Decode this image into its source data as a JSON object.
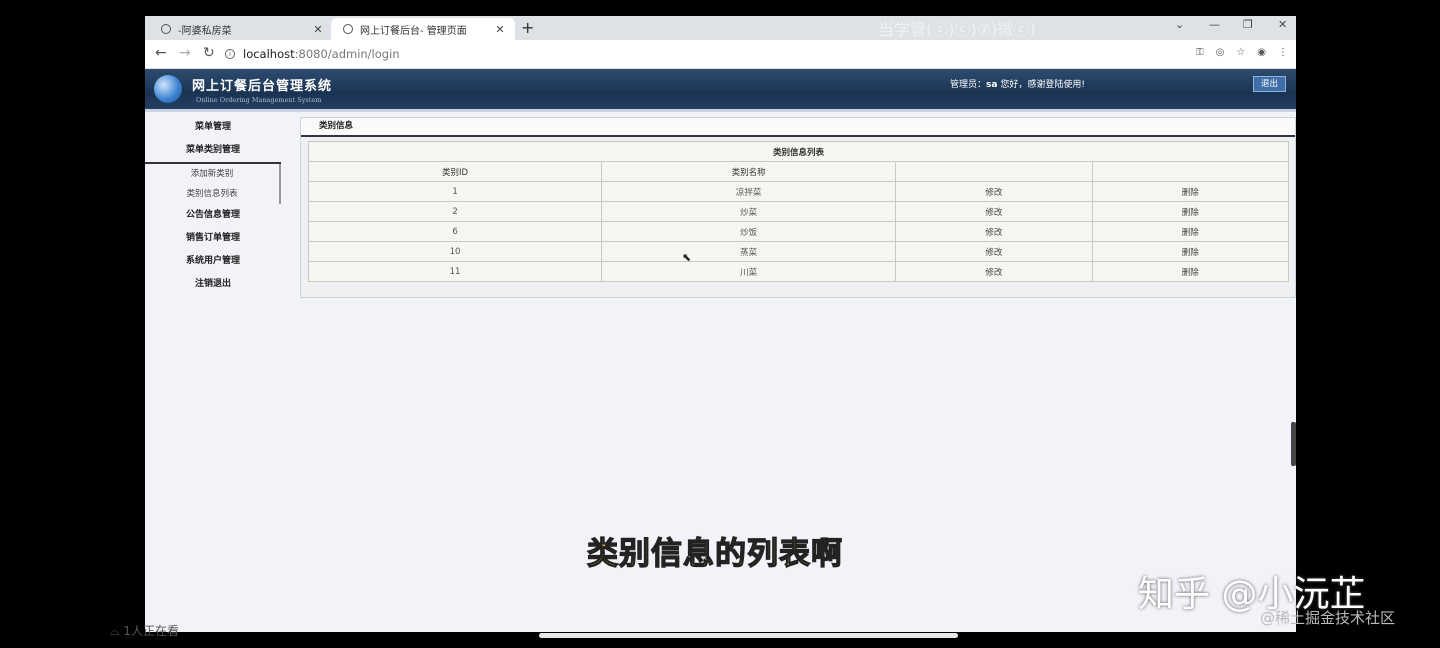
{
  "browser": {
    "tabs": [
      {
        "title": "-阿婆私房菜"
      },
      {
        "title": "网上订餐后台- 管理页面"
      }
    ],
    "new_tab": "+",
    "close_glyph": "✕",
    "url_host": "localhost",
    "url_path": ":8080/admin/login",
    "window_controls": [
      "⌄",
      "—",
      "❐",
      "✕"
    ],
    "overlay_text": "当学管(ⓒ)ⓒ)⑦)微ⓒ)"
  },
  "app": {
    "title": "网上订餐后台管理系统",
    "subtitle": "Online Ordering Management System",
    "greeting_prefix": "管理员：",
    "admin_name": "sa",
    "greeting_suffix": " 您好，感谢登陆使用!",
    "logout_label": "退出"
  },
  "sidebar": {
    "items": [
      {
        "label": "菜单管理"
      },
      {
        "label": "菜单类别管理"
      },
      {
        "label": "公告信息管理"
      },
      {
        "label": "销售订单管理"
      },
      {
        "label": "系统用户管理"
      },
      {
        "label": "注销退出"
      }
    ],
    "sub_items": [
      {
        "label": "添加新类别"
      },
      {
        "label": "类别信息列表"
      }
    ]
  },
  "panel": {
    "title": "类别信息",
    "table_caption": "类别信息列表",
    "columns": [
      "类别ID",
      "类别名称",
      "",
      ""
    ],
    "rows": [
      {
        "id": "1",
        "name": "凉拌菜",
        "edit": "修改",
        "delete": "删除"
      },
      {
        "id": "2",
        "name": "炒菜",
        "edit": "修改",
        "delete": "删除"
      },
      {
        "id": "6",
        "name": "炒饭",
        "edit": "修改",
        "delete": "删除"
      },
      {
        "id": "10",
        "name": "蒸菜",
        "edit": "修改",
        "delete": "删除"
      },
      {
        "id": "11",
        "name": "川菜",
        "edit": "修改",
        "delete": "删除"
      }
    ]
  },
  "overlay": {
    "subtitle": "类别信息的列表啊",
    "zhihu_watermark": "知乎 @小沅芷",
    "juejin_watermark": "@稀土掘金技术社区",
    "viewers": "1人正在看"
  },
  "colors": {
    "header_bg": "#1a3352",
    "page_bg": "#f1f3f8",
    "subtitle": "#ffe23a"
  }
}
